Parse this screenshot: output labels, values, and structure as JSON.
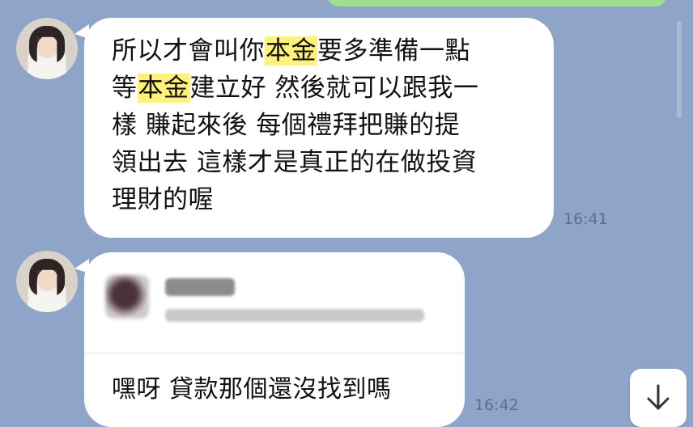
{
  "messages": [
    {
      "line1_pre": "所以才會叫你",
      "line1_hl": "本金",
      "line1_post": "要多準備一點",
      "line2_pre": "等",
      "line2_hl": "本金",
      "line2_post": "建立好 然後就可以跟我一",
      "line3": "樣 賺起來後 每個禮拜把賺的提",
      "line4": "領出去 這樣才是真正的在做投資",
      "line5": "理財的喔",
      "time": "16:41"
    },
    {
      "reply_text": "嘿呀 貸款那個還沒找到嗎",
      "time": "16:42"
    }
  ],
  "icons": {
    "scroll_down": "arrow-down-icon"
  },
  "colors": {
    "background": "#8ea4c9",
    "bubble": "#ffffff",
    "highlight": "#fff27a",
    "sent_bubble": "#9fe08c"
  }
}
